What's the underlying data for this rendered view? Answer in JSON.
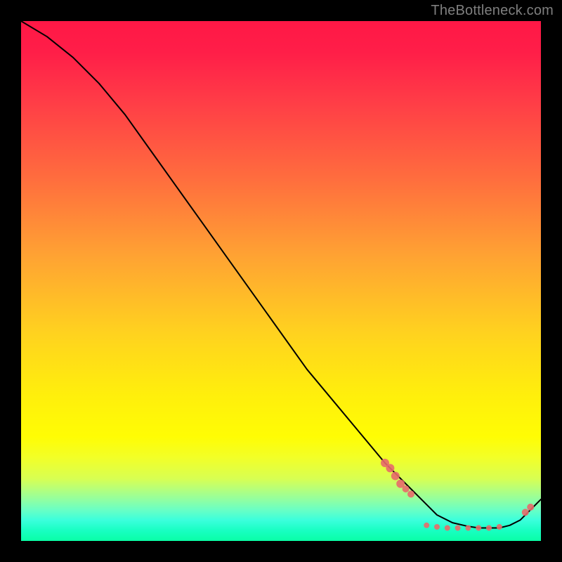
{
  "watermark": "TheBottleneck.com",
  "chart_data": {
    "type": "line",
    "title": "",
    "xlabel": "",
    "ylabel": "",
    "xlim": [
      0,
      100
    ],
    "ylim": [
      0,
      100
    ],
    "grid": false,
    "legend": false,
    "series": [
      {
        "name": "bottleneck-curve",
        "color": "#000000",
        "x": [
          0,
          5,
          10,
          15,
          20,
          25,
          30,
          35,
          40,
          45,
          50,
          55,
          60,
          65,
          70,
          72,
          75,
          78,
          80,
          83,
          86,
          88,
          90,
          92,
          94,
          96,
          98,
          100
        ],
        "y": [
          100,
          97,
          93,
          88,
          82,
          75,
          68,
          61,
          54,
          47,
          40,
          33,
          27,
          21,
          15,
          13,
          10,
          7,
          5,
          3.5,
          2.8,
          2.5,
          2.5,
          2.5,
          3,
          4,
          6,
          8
        ]
      }
    ],
    "markers": [
      {
        "name": "cluster-descend-1",
        "x": 70,
        "y": 15,
        "r": 6
      },
      {
        "name": "cluster-descend-2",
        "x": 71,
        "y": 14,
        "r": 6
      },
      {
        "name": "cluster-descend-3",
        "x": 72,
        "y": 12.5,
        "r": 6
      },
      {
        "name": "cluster-descend-4",
        "x": 73,
        "y": 11,
        "r": 6
      },
      {
        "name": "cluster-descend-5",
        "x": 74,
        "y": 10,
        "r": 5
      },
      {
        "name": "cluster-descend-6",
        "x": 75,
        "y": 9,
        "r": 5
      },
      {
        "name": "bottom-1",
        "x": 78,
        "y": 3.0,
        "r": 4
      },
      {
        "name": "bottom-2",
        "x": 80,
        "y": 2.7,
        "r": 4
      },
      {
        "name": "bottom-3",
        "x": 82,
        "y": 2.5,
        "r": 4
      },
      {
        "name": "bottom-4",
        "x": 84,
        "y": 2.5,
        "r": 4
      },
      {
        "name": "bottom-5",
        "x": 86,
        "y": 2.5,
        "r": 4
      },
      {
        "name": "bottom-6",
        "x": 88,
        "y": 2.5,
        "r": 4
      },
      {
        "name": "bottom-7",
        "x": 90,
        "y": 2.5,
        "r": 4
      },
      {
        "name": "bottom-8",
        "x": 92,
        "y": 2.7,
        "r": 4
      },
      {
        "name": "ascend-1",
        "x": 97,
        "y": 5.5,
        "r": 5
      },
      {
        "name": "ascend-2",
        "x": 98,
        "y": 6.5,
        "r": 5
      }
    ],
    "marker_color": "#e86a6a"
  }
}
